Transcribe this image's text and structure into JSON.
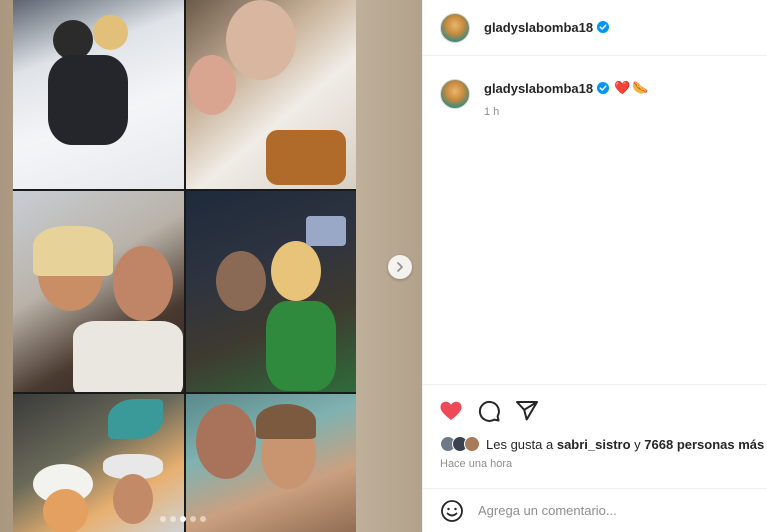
{
  "post": {
    "username": "gladyslabomba18",
    "verified": true
  },
  "caption": {
    "username": "gladyslabomba18",
    "emojis": [
      "❤️",
      "🌭"
    ],
    "time": "1 h"
  },
  "carousel": {
    "photo_count": 6,
    "next_icon": "chevron-right-icon",
    "dots_total": 5,
    "dots_active": 3
  },
  "actions": {
    "like_icon": "heart-filled-icon",
    "comment_icon": "comment-icon",
    "share_icon": "send-icon",
    "like_color": "#ed4956"
  },
  "likes": {
    "prefix": "Les gusta a",
    "user": "sabri_sistro",
    "middle": "y",
    "count_text": "7668 personas más"
  },
  "posted_ago": "Hace una hora",
  "comment_box": {
    "placeholder": "Agrega un comentario...",
    "emoji_icon": "smiley-icon"
  },
  "colors": {
    "verified": "#0095f6",
    "heart": "#ed4956",
    "muted_text": "#8e8e8e"
  }
}
